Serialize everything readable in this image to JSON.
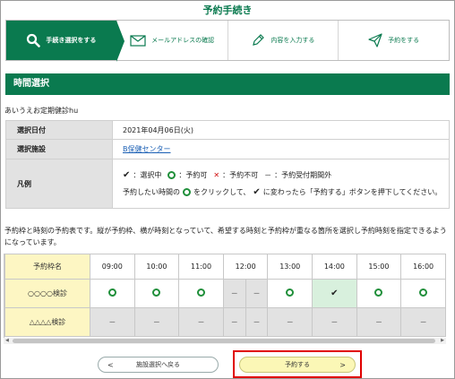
{
  "page": {
    "title": "予約手続き"
  },
  "steps": [
    {
      "label": "手続き選択をする",
      "icon": "search-icon"
    },
    {
      "label": "メールアドレスの確認",
      "icon": "envelope-icon"
    },
    {
      "label": "内容を入力する",
      "icon": "pencil-icon"
    },
    {
      "label": "予約をする",
      "icon": "paper-plane-icon"
    }
  ],
  "section": {
    "title": "時間選択"
  },
  "course_name": "あいうえお定期健診hu",
  "info": {
    "date_label": "選択日付",
    "date_value": "2021年04月06日(火)",
    "facility_label": "選択施設",
    "facility_value": "B保健センター",
    "legend_label": "凡例",
    "legend_selected": "：選択中",
    "legend_available": "：予約可",
    "legend_unavailable": "：予約不可",
    "legend_outside": "：予約受付期間外",
    "legend_mark_dash": "－",
    "legend_instruction_pre": "予約したい時間の",
    "legend_instruction_post": "をクリックして、",
    "legend_instruction_end": "に変わったら「予約する」ボタンを押下してください。"
  },
  "description": "予約枠と時刻の予約表です。縦が予約枠、横が時刻となっていて、希望する時刻と予約枠が重なる箇所を選択し予約時刻を指定できるようになっています。",
  "schedule": {
    "corner_label": "予約枠名",
    "times": [
      "09:00",
      "10:00",
      "11:00",
      "12:00",
      "13:00",
      "14:00",
      "15:00",
      "16:00"
    ],
    "rows": [
      {
        "name": "○○○○検診",
        "cells": [
          "available",
          "available",
          "available",
          "unavailable-split",
          "available",
          "selected",
          "available",
          "available"
        ]
      },
      {
        "name": "△△△△検診",
        "cells": [
          "closed",
          "closed",
          "closed",
          "closed-split",
          "closed",
          "closed",
          "closed",
          "closed"
        ]
      }
    ],
    "dash": "－"
  },
  "buttons": {
    "back_label": "施設選択へ戻る",
    "back_arrow": "<",
    "reserve_label": "予約する",
    "reserve_arrow": ">"
  },
  "colors": {
    "brand": "#0a7a4f",
    "available": "#1f8f3a",
    "unavailable": "#d01010",
    "highlight": "#e00000",
    "selected_bg": "#d8f0dd",
    "rowname_bg": "#fdf6c3"
  }
}
